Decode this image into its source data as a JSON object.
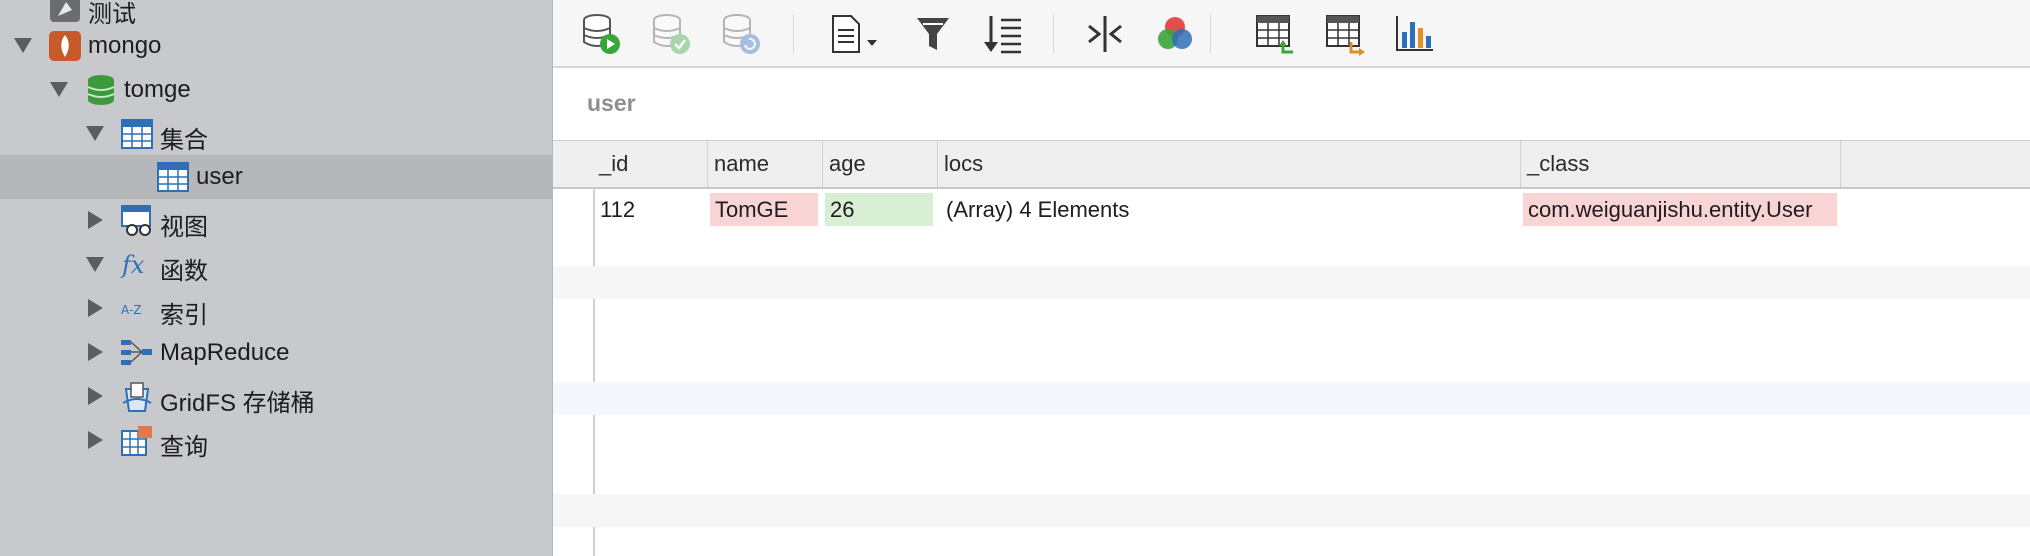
{
  "sidebar": {
    "items": [
      {
        "label": "测试",
        "icon": "connection-icon"
      },
      {
        "label": "mongo",
        "icon": "mongodb-leaf-icon"
      },
      {
        "label": "tomge",
        "icon": "database-icon"
      },
      {
        "label": "集合",
        "icon": "collections-table-icon"
      },
      {
        "label": "user",
        "icon": "table-icon"
      },
      {
        "label": "视图",
        "icon": "view-icon"
      },
      {
        "label": "函数",
        "icon": "function-fx-icon"
      },
      {
        "label": "索引",
        "icon": "index-az-icon"
      },
      {
        "label": "MapReduce",
        "icon": "mapreduce-icon"
      },
      {
        "label": "GridFS 存储桶",
        "icon": "gridfs-bucket-icon"
      },
      {
        "label": "查询",
        "icon": "query-icon"
      }
    ],
    "selected": "user"
  },
  "toolbar": {
    "buttons": [
      "run-icon",
      "commit-icon",
      "refresh-icon",
      "document-view-icon",
      "filter-icon",
      "sort-icon",
      "split-icon",
      "color-icon",
      "import-icon",
      "export-icon",
      "chart-icon"
    ]
  },
  "collection": {
    "title": "user"
  },
  "table": {
    "columns": [
      "_id",
      "name",
      "age",
      "locs",
      "_class"
    ],
    "rows": [
      {
        "_id": "112",
        "name": "TomGE",
        "age": "26",
        "locs": "(Array) 4 Elements",
        "_class": "com.weiguanjishu.entity.User"
      }
    ]
  },
  "colors": {
    "string_cell": "#f8d4d4",
    "number_cell": "#d8efd3",
    "selected_row": "#b6b7bb"
  }
}
